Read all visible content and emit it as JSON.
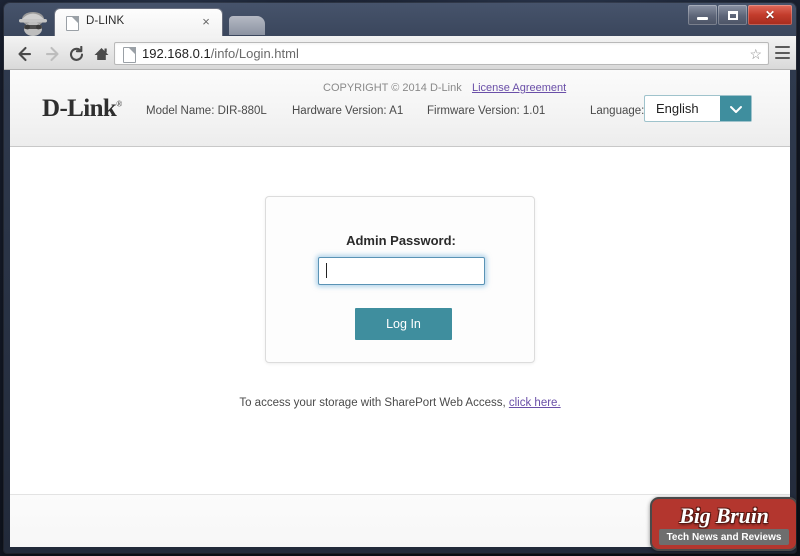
{
  "window": {
    "controls": {
      "minimize_label": "Minimize",
      "maximize_label": "Maximize",
      "close_label": "Close"
    }
  },
  "browser": {
    "profile_icon": "incognito-icon",
    "tab": {
      "title": "D-LINK",
      "close_label": "×",
      "favicon": "page-icon"
    },
    "new_tab_label": "New tab",
    "toolbar": {
      "back_label": "Back",
      "forward_label": "Forward",
      "reload_label": "Reload",
      "home_label": "Home",
      "menu_label": "Menu"
    },
    "omnibox": {
      "host": "192.168.0.1",
      "path": "/info/Login.html",
      "full_url": "192.168.0.1/info/Login.html",
      "page_icon": "page-icon",
      "bookmark_icon": "star-icon"
    }
  },
  "device_header": {
    "brand": "D-Link",
    "registered_mark": "®",
    "model": "Model Name: DIR-880L",
    "hardware": "Hardware Version: A1",
    "firmware": "Firmware Version: 1.01",
    "language_label": "Language:",
    "language_value": "English",
    "language_options": [
      "English"
    ],
    "dropdown_icon": "chevron-down-icon",
    "accent_color": "#3f8e9e"
  },
  "login": {
    "title": "Admin Password:",
    "password_value": "",
    "password_placeholder": "",
    "submit_label": "Log In"
  },
  "shareport": {
    "text": "To access your storage with SharePort Web Access,",
    "link_label": "click here."
  },
  "footer": {
    "copyright": "COPYRIGHT © 2014 D-Link",
    "license_label": "License Agreement"
  },
  "watermark": {
    "title": "Big Bruin",
    "subtitle": "Tech News and Reviews",
    "bg_color": "#b3362e"
  }
}
